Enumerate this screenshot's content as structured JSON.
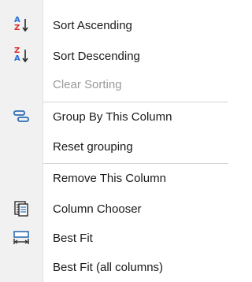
{
  "menu": {
    "items": [
      {
        "label": "Sort Ascending",
        "icon": "sort-ascending-icon",
        "enabled": true
      },
      {
        "label": "Sort Descending",
        "icon": "sort-descending-icon",
        "enabled": true
      },
      {
        "label": "Clear Sorting",
        "icon": "",
        "enabled": false
      },
      {
        "label": "Group By This Column",
        "icon": "group-by-icon",
        "enabled": true
      },
      {
        "label": "Reset grouping",
        "icon": "",
        "enabled": true
      },
      {
        "label": "Remove This Column",
        "icon": "",
        "enabled": true
      },
      {
        "label": "Column Chooser",
        "icon": "column-chooser-icon",
        "enabled": true
      },
      {
        "label": "Best Fit",
        "icon": "best-fit-icon",
        "enabled": true
      },
      {
        "label": "Best Fit (all columns)",
        "icon": "",
        "enabled": true
      }
    ],
    "icon_glyphs": {
      "asc_top": "A",
      "asc_bottom": "Z",
      "desc_top": "Z",
      "desc_bottom": "A"
    }
  },
  "colors": {
    "letter_blue": "#2b6fd6",
    "letter_red": "#d92b2b",
    "icon_blue": "#2f6db5",
    "disabled_text": "#9a9a9a"
  }
}
